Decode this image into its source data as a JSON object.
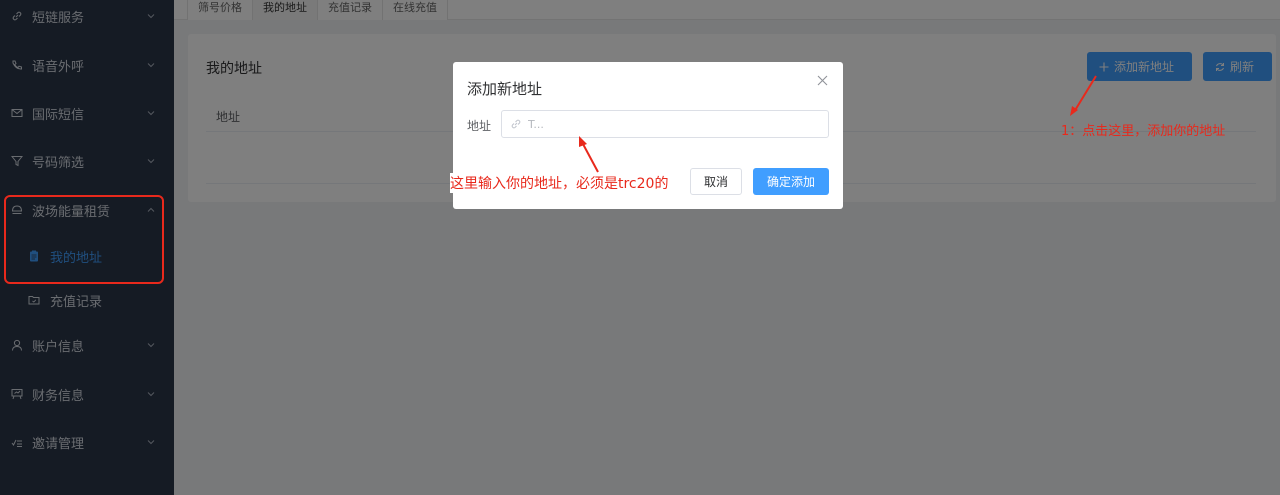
{
  "sidebar": {
    "items": [
      {
        "label": "短链服务",
        "icon": "link-icon"
      },
      {
        "label": "语音外呼",
        "icon": "phone-icon"
      },
      {
        "label": "国际短信",
        "icon": "mail-icon"
      },
      {
        "label": "号码筛选",
        "icon": "filter-icon"
      },
      {
        "label": "波场能量租赁",
        "icon": "energy-icon"
      },
      {
        "label": "账户信息",
        "icon": "user-icon"
      },
      {
        "label": "财务信息",
        "icon": "finance-icon"
      },
      {
        "label": "邀请管理",
        "icon": "invite-icon"
      }
    ],
    "sub_items": [
      {
        "label": "我的地址",
        "icon": "clipboard-icon"
      },
      {
        "label": "充值记录",
        "icon": "folder-icon"
      }
    ]
  },
  "tabs": [
    "筛号价格",
    "我的地址",
    "充值记录",
    "在线充值"
  ],
  "card": {
    "title": "我的地址",
    "add_button": "添加新地址",
    "refresh_button": "刷新",
    "column_address": "地址"
  },
  "dialog": {
    "title": "添加新地址",
    "field_label": "地址",
    "placeholder": "T...",
    "cancel": "取消",
    "confirm": "确定添加"
  },
  "annotations": {
    "step1": "1：点击这里，添加你的地址",
    "step2": "这里输入你的地址，必须是trc20的"
  },
  "colors": {
    "sidebar_bg": "#2b3648",
    "primary": "#409eff",
    "annotation": "#e8291c"
  }
}
